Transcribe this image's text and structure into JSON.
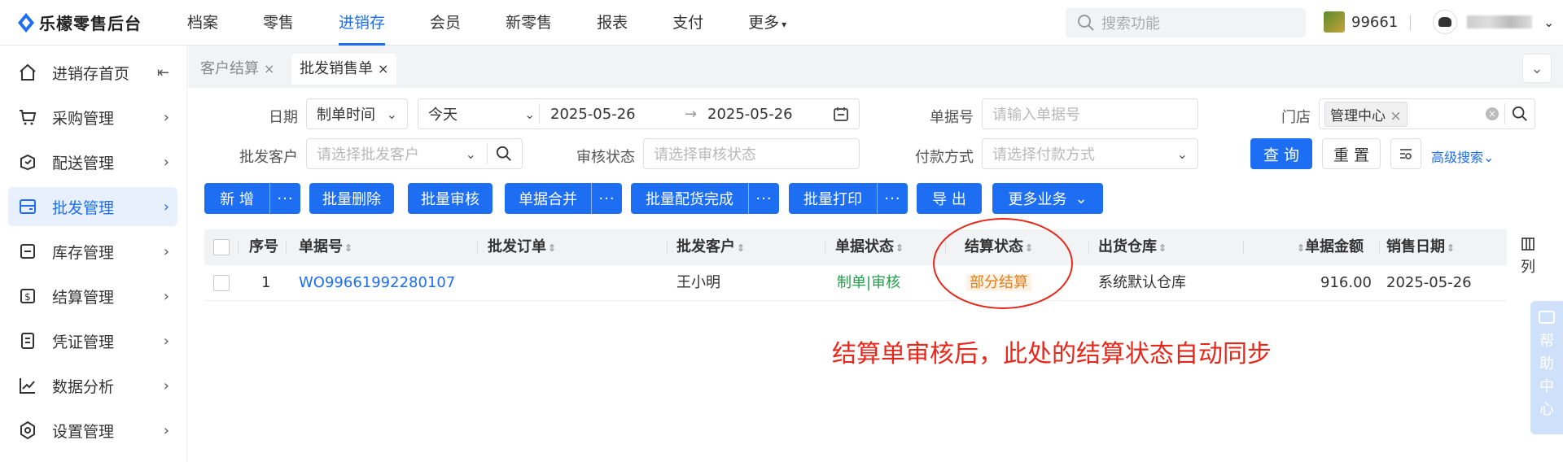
{
  "app": {
    "title": "乐檬零售后台"
  },
  "topnav": [
    {
      "label": "档案",
      "active": false
    },
    {
      "label": "零售",
      "active": false
    },
    {
      "label": "进销存",
      "active": true
    },
    {
      "label": "会员",
      "active": false
    },
    {
      "label": "新零售",
      "active": false
    },
    {
      "label": "报表",
      "active": false
    },
    {
      "label": "支付",
      "active": false
    },
    {
      "label": "更多",
      "active": false
    }
  ],
  "search": {
    "placeholder": "搜索功能"
  },
  "store": {
    "id": "99661"
  },
  "sidebar": {
    "items": [
      {
        "label": "进销存首页",
        "icon": "home-icon"
      },
      {
        "label": "采购管理",
        "icon": "cart-icon"
      },
      {
        "label": "配送管理",
        "icon": "delivery-icon"
      },
      {
        "label": "批发管理",
        "icon": "wholesale-icon",
        "active": true
      },
      {
        "label": "库存管理",
        "icon": "inventory-icon"
      },
      {
        "label": "结算管理",
        "icon": "settlement-icon"
      },
      {
        "label": "凭证管理",
        "icon": "voucher-icon"
      },
      {
        "label": "数据分析",
        "icon": "chart-icon"
      },
      {
        "label": "设置管理",
        "icon": "settings-icon"
      }
    ]
  },
  "tabs": [
    {
      "label": "客户结算",
      "active": false
    },
    {
      "label": "批发销售单",
      "active": true
    }
  ],
  "filters": {
    "date_label": "日期",
    "date_type": "制单时间",
    "date_range": "今天",
    "date_start": "2025-05-26",
    "date_end": "2025-05-26",
    "order_no_label": "单据号",
    "order_no_placeholder": "请输入单据号",
    "store_label": "门店",
    "store_value": "管理中心",
    "customer_label": "批发客户",
    "customer_placeholder": "请选择批发客户",
    "audit_label": "审核状态",
    "audit_placeholder": "请选择审核状态",
    "payment_label": "付款方式",
    "payment_placeholder": "请选择付款方式",
    "query": "查 询",
    "reset": "重 置",
    "advanced": "高级搜索"
  },
  "toolbar": {
    "add": "新 增",
    "batch_delete": "批量删除",
    "batch_audit": "批量审核",
    "merge": "单据合并",
    "batch_allot": "批量配货完成",
    "batch_print": "批量打印",
    "export": "导 出",
    "more_business": "更多业务"
  },
  "table": {
    "headers": [
      "序号",
      "单据号",
      "批发订单",
      "批发客户",
      "单据状态",
      "结算状态",
      "出货仓库",
      "单据金额",
      "销售日期"
    ],
    "column_setting": "列",
    "rows": [
      {
        "seq": "1",
        "order_no": "WO99661992280107",
        "wholesale_order": "",
        "customer": "王小明",
        "doc_status": "制单|审核",
        "settle_status": "部分结算",
        "warehouse": "系统默认仓库",
        "amount": "916.00",
        "date": "2025-05-26"
      }
    ]
  },
  "annotation": "结算单审核后，此处的结算状态自动同步",
  "help": {
    "chars": [
      "帮",
      "助",
      "中",
      "心"
    ]
  },
  "colors": {
    "primary": "#1d6ef2",
    "annotation": "#e8261a",
    "settle_status": "#e07e1a",
    "doc_status": "#22a04b"
  }
}
